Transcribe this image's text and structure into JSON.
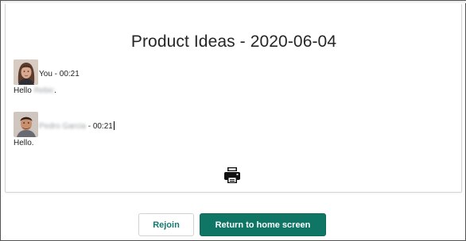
{
  "meeting": {
    "title": "Product Ideas - 2020-06-04"
  },
  "messages": [
    {
      "sender": "You",
      "sender_blurred": false,
      "separator": " - ",
      "time": "00:21",
      "text_prefix": "Hello ",
      "text_blurred_name": "Rebic",
      "text_suffix": ".",
      "avatar": "female-avatar"
    },
    {
      "sender": "Pedro Garcia",
      "sender_blurred": true,
      "separator": " - ",
      "time": "00:21",
      "text_prefix": "Hello.",
      "text_blurred_name": "",
      "text_suffix": "",
      "avatar": "male-avatar"
    }
  ],
  "icons": {
    "print": "printer-icon"
  },
  "actions": {
    "rejoin_label": "Rejoin",
    "home_label": "Return to home screen"
  },
  "colors": {
    "primary": "#0f7565",
    "primary_text": "#ffffff",
    "secondary_text": "#137a6c"
  }
}
